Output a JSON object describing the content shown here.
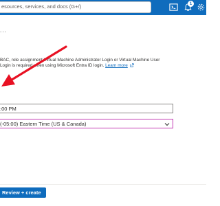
{
  "header": {
    "search_text": "esources, services, and docs (G+/)",
    "notification_count": "1",
    "icons": [
      "cloud-shell-icon",
      "notifications-icon",
      "settings-icon"
    ]
  },
  "page": {
    "ellipsis": "...",
    "info_text": "BAC, role assignment Virtual Machine Administrator Login or Virtual Machine User Login is required when using Microsoft Entra ID login.",
    "info_link": "Learn more"
  },
  "form": {
    "shutdown_time": ":00 PM",
    "time_zone": "(-05:00) Eastern Time (US & Canada)"
  },
  "footer": {
    "review_button": "Review + create"
  },
  "colors": {
    "header_blue": "#0f6cbd",
    "annotation_red": "#e81123",
    "focus_border": "#c239b3"
  }
}
